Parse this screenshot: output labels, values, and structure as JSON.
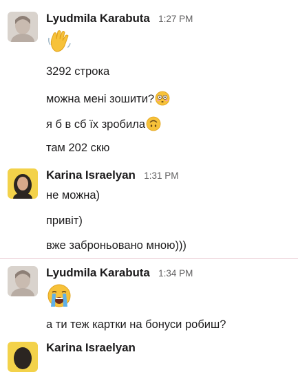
{
  "messages": [
    {
      "author": "Lyudmila Karabuta",
      "time": "1:27 PM",
      "lines": [
        {
          "text": "",
          "emoji": "waving-hand"
        },
        {
          "text": "3292 строка"
        },
        {
          "text": "можна мені зошити?",
          "emoji": "flushed-face"
        },
        {
          "text": "я б в сб їх зробила",
          "emoji": "upside-down-face"
        },
        {
          "text": "там 202 скю"
        }
      ]
    },
    {
      "author": "Karina Israelyan",
      "time": "1:31 PM",
      "lines": [
        {
          "text": "не можна)"
        },
        {
          "text": "привіт)"
        },
        {
          "text": "вже заброньовано мною)))"
        }
      ]
    },
    {
      "author": "Lyudmila Karabuta",
      "time": "1:34 PM",
      "lines": [
        {
          "text": "",
          "emoji": "loudly-crying-face"
        },
        {
          "text": "а ти теж картки на бонуси робиш?"
        }
      ]
    },
    {
      "author": "Karina Israelyan",
      "time": ""
    }
  ],
  "colors": {
    "new_divider": "#e8c6cf",
    "author": "#1d1c1d",
    "timestamp": "#616061"
  }
}
